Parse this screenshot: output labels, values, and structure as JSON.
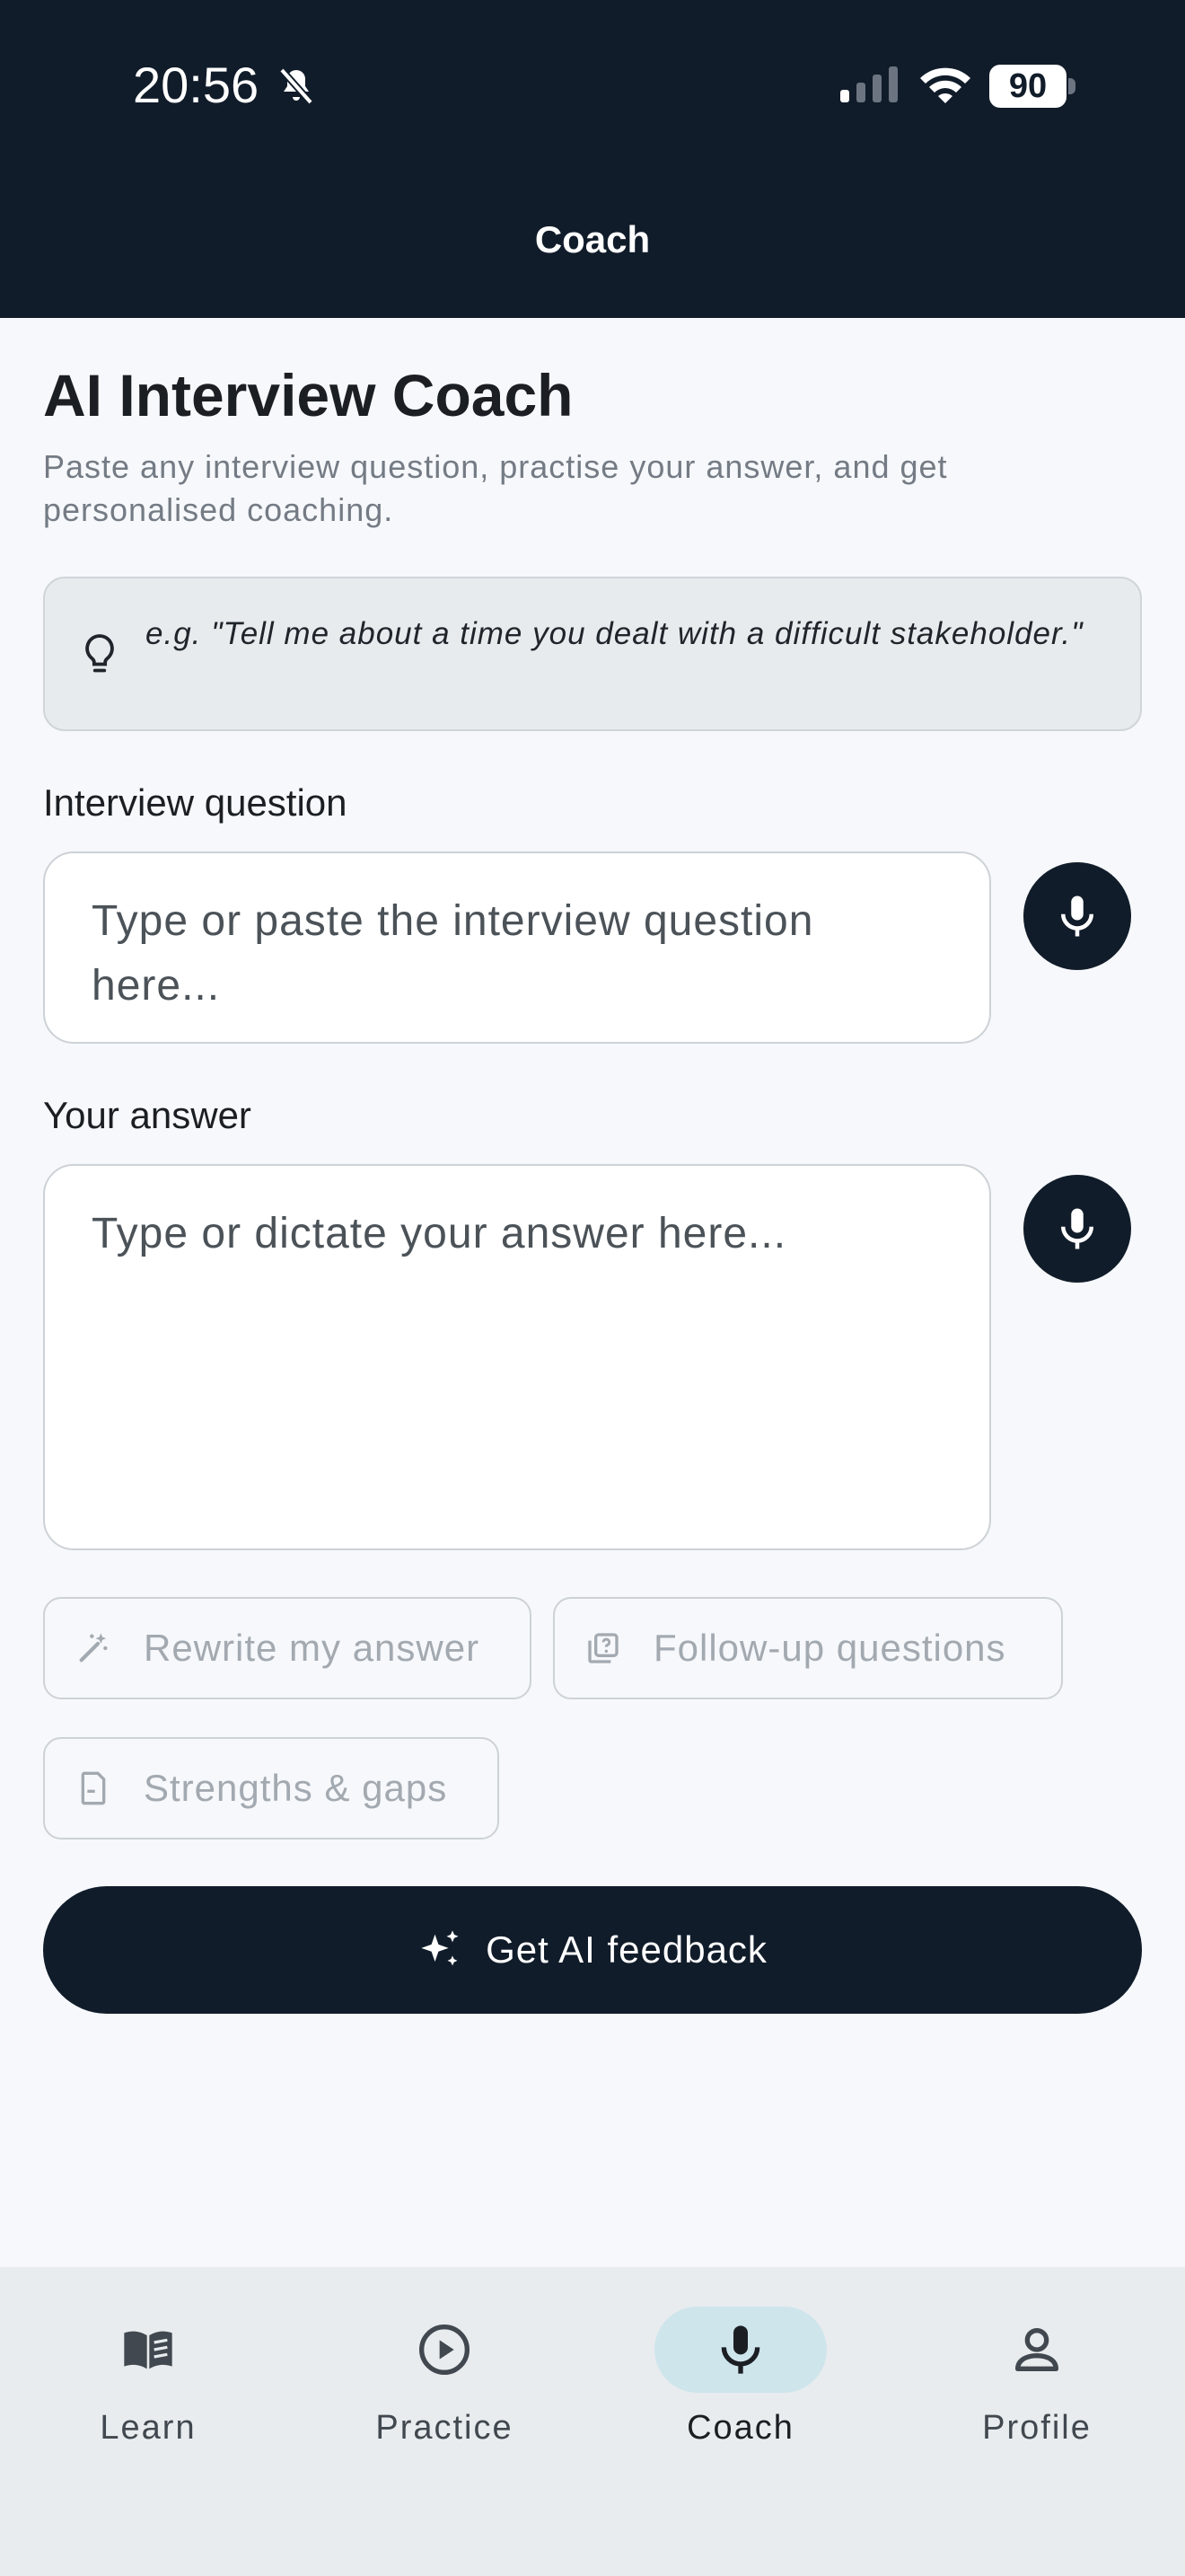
{
  "status_bar": {
    "time": "20:56",
    "battery": "90",
    "icons": [
      "bell-off-icon",
      "signal-icon",
      "wifi-icon",
      "battery-icon"
    ]
  },
  "header": {
    "title": "Coach"
  },
  "main": {
    "title": "AI Interview Coach",
    "subtitle": "Paste any interview question, practise your answer, and get personalised coaching.",
    "hint": {
      "icon": "lightbulb-icon",
      "text": "e.g. \"Tell me about a time you dealt with a difficult stakeholder.\""
    },
    "question_field": {
      "label": "Interview question",
      "placeholder": "Type or paste the interview question here...",
      "value": "",
      "mic_icon": "mic-icon"
    },
    "answer_field": {
      "label": "Your answer",
      "placeholder": "Type or dictate your answer here...",
      "value": "",
      "mic_icon": "mic-icon"
    },
    "actions": [
      {
        "label": "Rewrite my answer",
        "icon": "magic-wand-icon"
      },
      {
        "label": "Follow-up questions",
        "icon": "question-stack-icon"
      },
      {
        "label": "Strengths & gaps",
        "icon": "document-icon"
      }
    ],
    "cta": {
      "label": "Get AI feedback",
      "icon": "sparkles-icon"
    }
  },
  "bottom_nav": {
    "items": [
      {
        "label": "Learn",
        "icon": "book-icon",
        "active": false
      },
      {
        "label": "Practice",
        "icon": "play-circle-icon",
        "active": false
      },
      {
        "label": "Coach",
        "icon": "mic-icon",
        "active": true
      },
      {
        "label": "Profile",
        "icon": "person-icon",
        "active": false
      }
    ]
  },
  "colors": {
    "header_bg": "#111c2a",
    "page_bg": "#f6f8fb",
    "primary": "#111c2a",
    "active_nav_pill": "#cfe5ec",
    "muted_text": "#747b84",
    "disabled_chip_text": "#a3a9b0"
  }
}
